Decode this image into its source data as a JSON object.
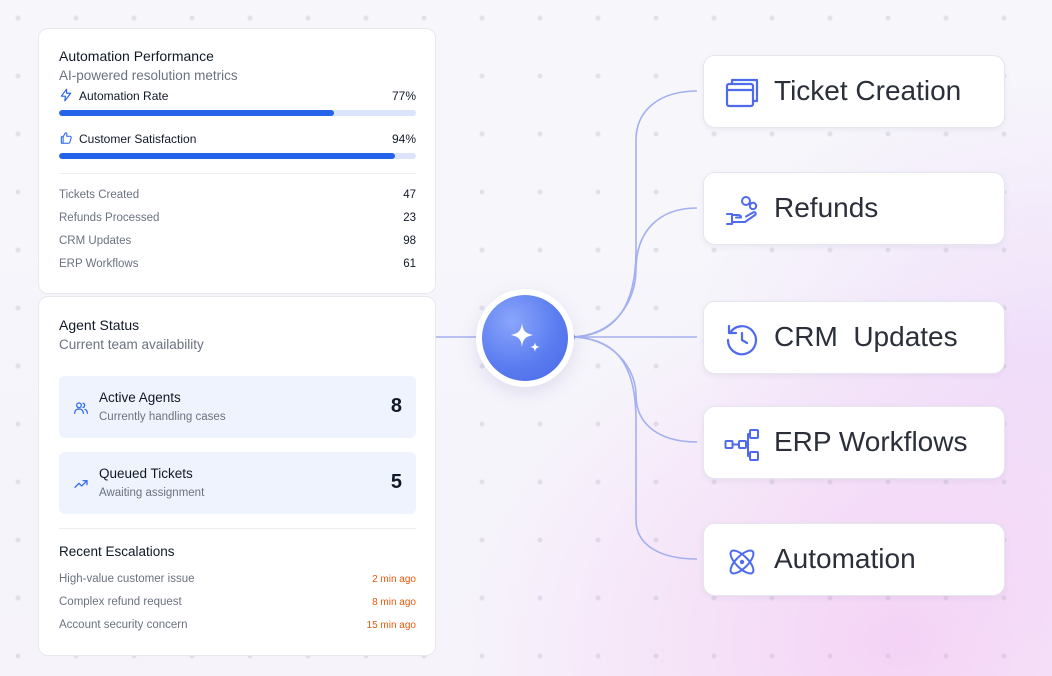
{
  "performance": {
    "title": "Automation Performance",
    "subtitle": "AI-powered resolution metrics",
    "metrics": [
      {
        "label": "Automation Rate",
        "value": "77%",
        "fill": 0.77
      },
      {
        "label": "Customer Satisfaction",
        "value": "94%",
        "fill": 0.94
      }
    ],
    "stats": [
      {
        "label": "Tickets Created",
        "value": "47"
      },
      {
        "label": "Refunds Processed",
        "value": "23"
      },
      {
        "label": "CRM Updates",
        "value": "98"
      },
      {
        "label": "ERP Workflows",
        "value": "61"
      }
    ]
  },
  "agents": {
    "title": "Agent Status",
    "subtitle": "Current team availability",
    "boxes": [
      {
        "title": "Active Agents",
        "sub": "Currently handling cases",
        "count": "8"
      },
      {
        "title": "Queued Tickets",
        "sub": "Awaiting assignment",
        "count": "5"
      }
    ]
  },
  "escalations": {
    "title": "Recent Escalations",
    "items": [
      {
        "label": "High-value customer issue",
        "time": "2 min ago"
      },
      {
        "label": "Complex refund request",
        "time": "8 min ago"
      },
      {
        "label": "Account security concern",
        "time": "15 min ago"
      }
    ]
  },
  "destinations": [
    {
      "label": "Ticket Creation",
      "icon": "window-icon"
    },
    {
      "label": "Refunds",
      "icon": "hand-coins-icon"
    },
    {
      "label": "CRM  Updates",
      "icon": "clock-refresh-icon"
    },
    {
      "label": "ERP Workflows",
      "icon": "workflow-icon"
    },
    {
      "label": "Automation",
      "icon": "atom-icon"
    }
  ],
  "colors": {
    "accent": "#2563eb",
    "escalation_time": "#e8590c",
    "hub": "#5b7df0",
    "connector": "#a3b0f0"
  }
}
